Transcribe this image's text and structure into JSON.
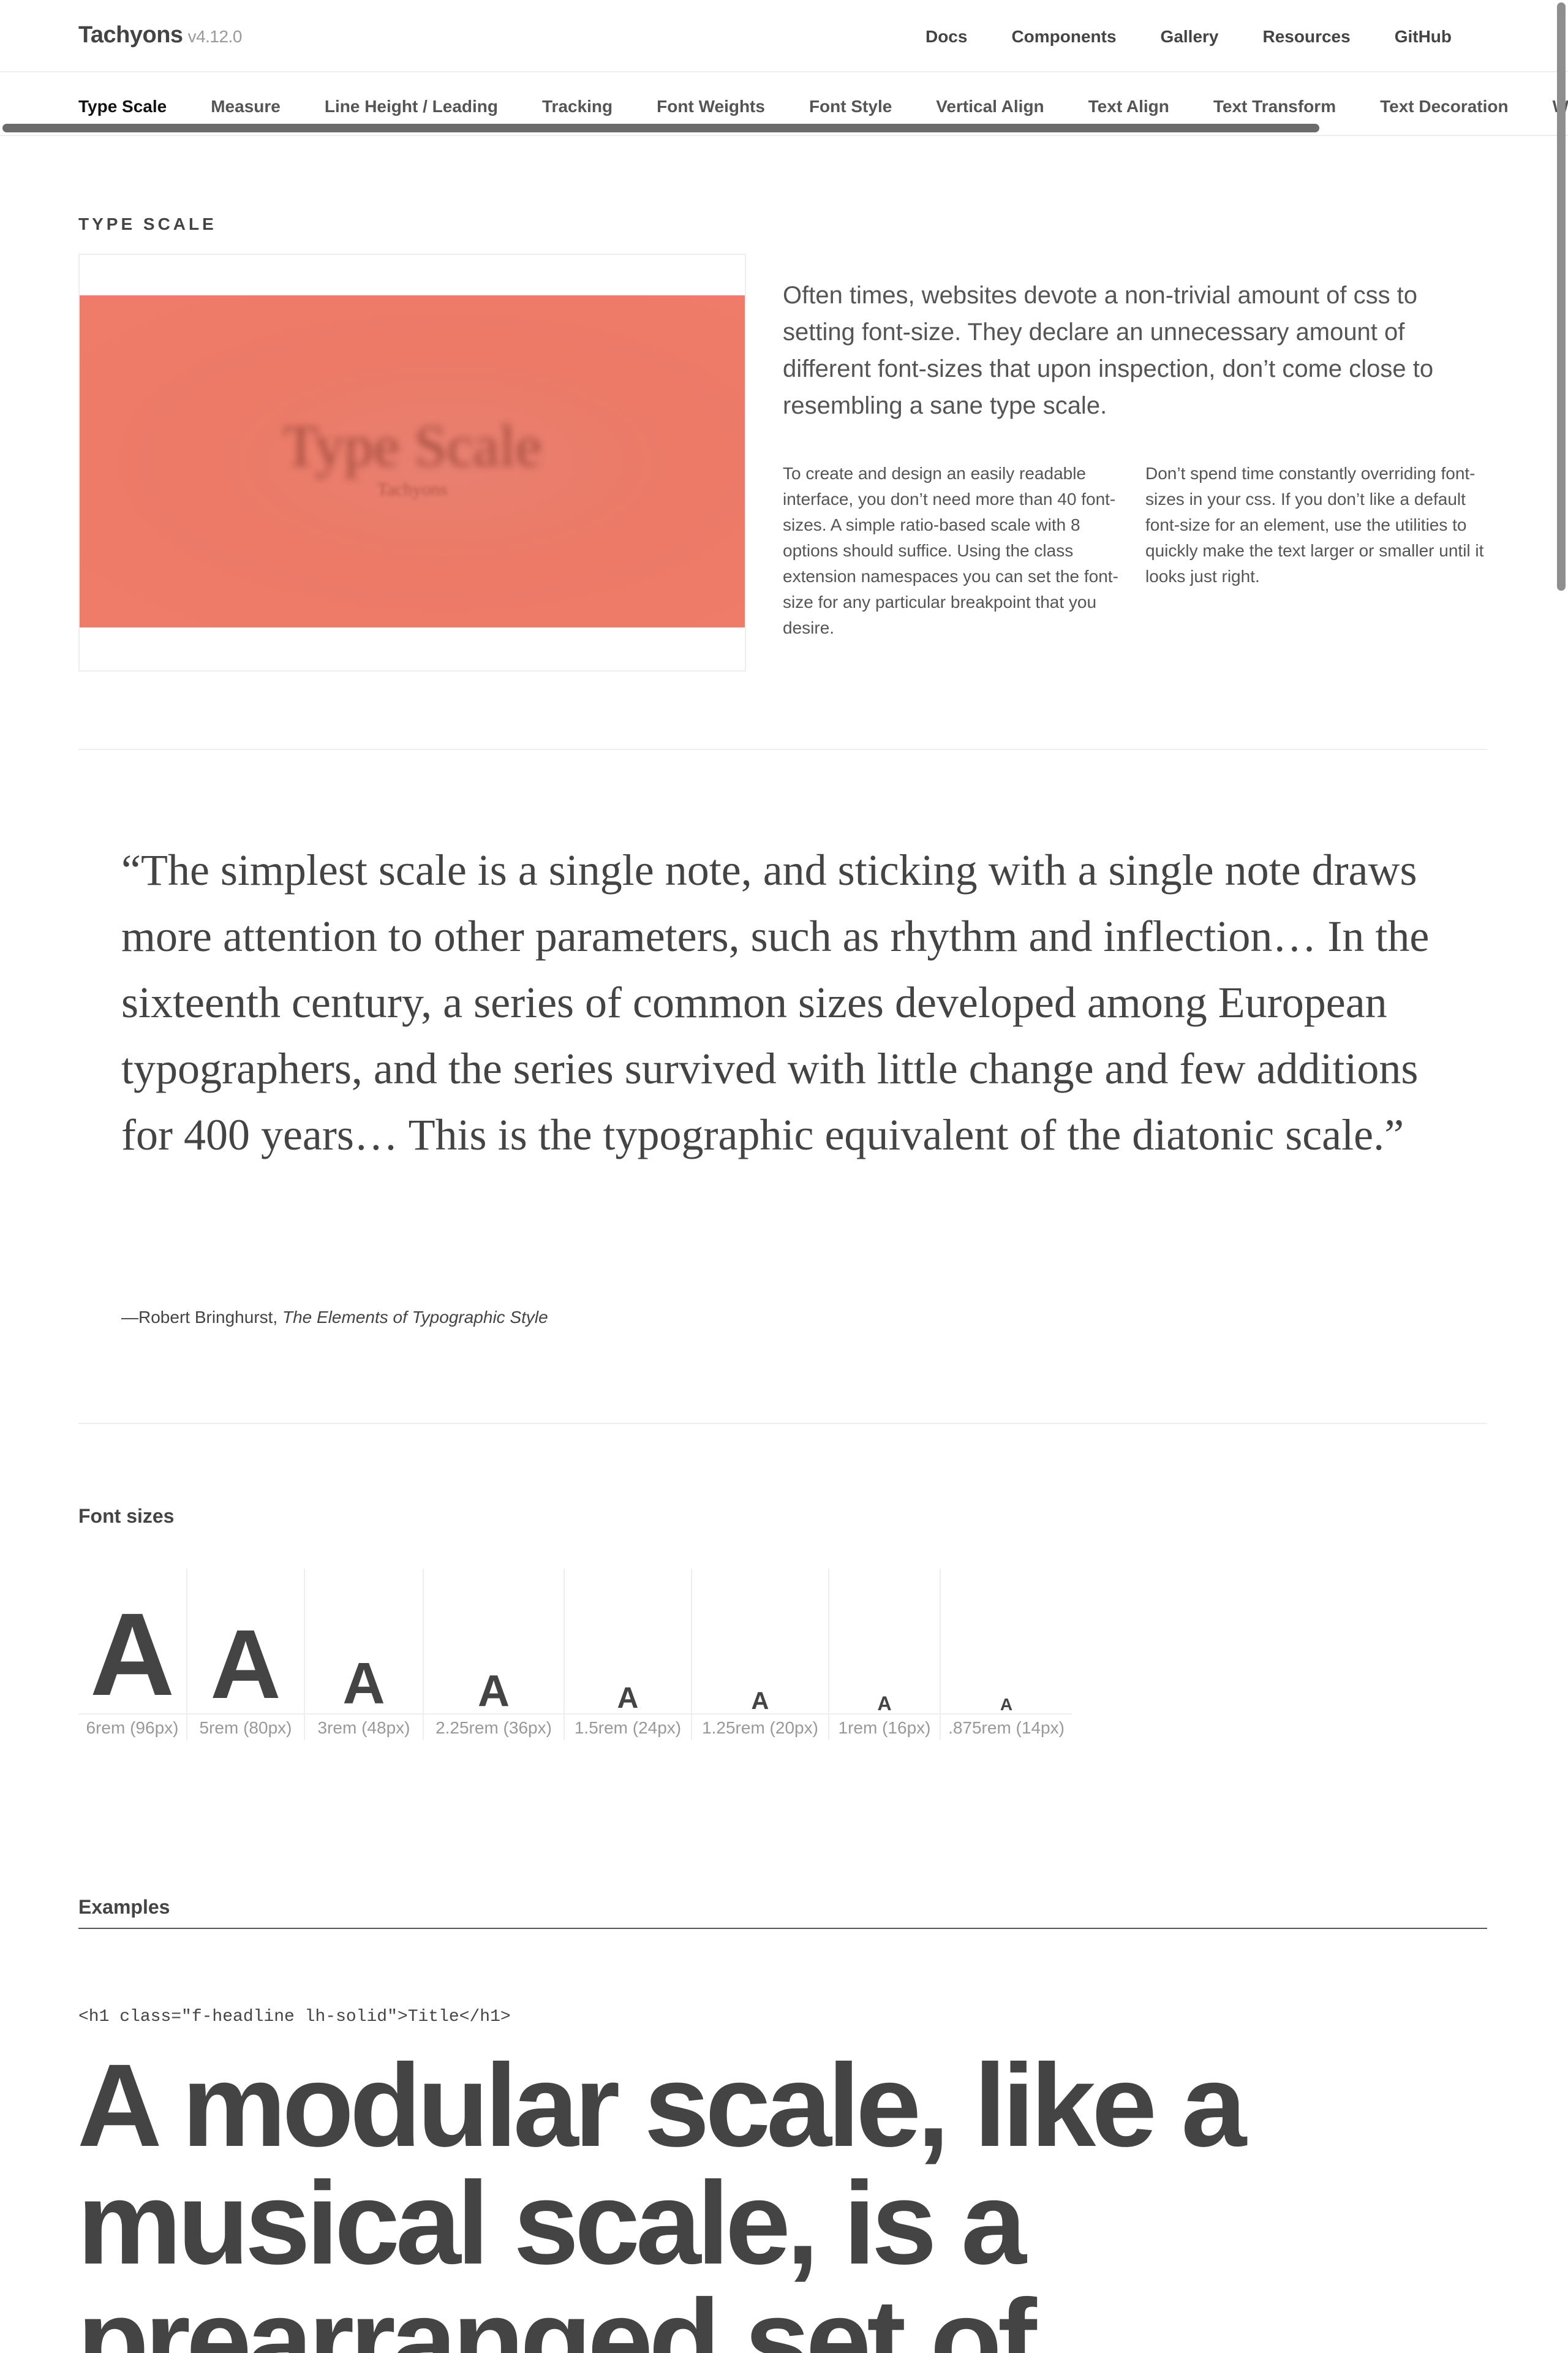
{
  "header": {
    "brand": "Tachyons",
    "version": "v4.12.0",
    "nav": [
      "Docs",
      "Components",
      "Gallery",
      "Resources",
      "GitHub"
    ]
  },
  "subnav": {
    "items": [
      "Type Scale",
      "Measure",
      "Line Height / Leading",
      "Tracking",
      "Font Weights",
      "Font Style",
      "Vertical Align",
      "Text Align",
      "Text Transform",
      "Text Decoration",
      "W"
    ],
    "active": "Type Scale"
  },
  "intro": {
    "section_title": "TYPE SCALE",
    "image_title": "Type Scale",
    "image_subtitle": "Tachyons",
    "lead": "Often times, websites devote a non-trivial amount of css to setting font-size. They declare an unnecessary amount of different font-sizes that upon inspection, don’t come close to resembling a sane type scale.",
    "col1": "To create and design an easily readable interface, you don’t need more than 40 font-sizes. A simple ratio-based scale with 8 options should suffice. Using the class extension namespaces you can set the font-size for any particular breakpoint that you desire.",
    "col2": "Don’t spend time constantly overriding font-sizes in your css. If you don’t like a default font-size for an element, use the utilities to quickly make the text larger or smaller until it looks just right."
  },
  "quote": {
    "text": "“The simplest scale is a single note, and sticking with a single note draws more attention to other parameters, such as rhythm and inflection… In the sixteenth century, a series of common sizes developed among European typographers, and the series survived with little change and few additions for 400 years… This is the typographic equivalent of the diatonic scale.”",
    "author": "—Robert Bringhurst, ",
    "book": "The Elements of Typographic Style"
  },
  "font_sizes": {
    "heading": "Font sizes",
    "glyph": "A",
    "items": [
      {
        "label": "6rem (96px)"
      },
      {
        "label": "5rem (80px)"
      },
      {
        "label": "3rem (48px)"
      },
      {
        "label": "2.25rem (36px)"
      },
      {
        "label": "1.5rem (24px)"
      },
      {
        "label": "1.25rem (20px)"
      },
      {
        "label": "1rem (16px)"
      },
      {
        "label": ".875rem (14px)"
      }
    ]
  },
  "examples": {
    "heading": "Examples",
    "code": "<h1 class=\"f-headline lh-solid\">Title</h1>",
    "headline": "A modular scale, like a musical scale, is a prearranged set of"
  },
  "colors": {
    "text": "#444444",
    "muted": "#999999",
    "hero": "#ee7c69",
    "border": "#eeeeee"
  }
}
